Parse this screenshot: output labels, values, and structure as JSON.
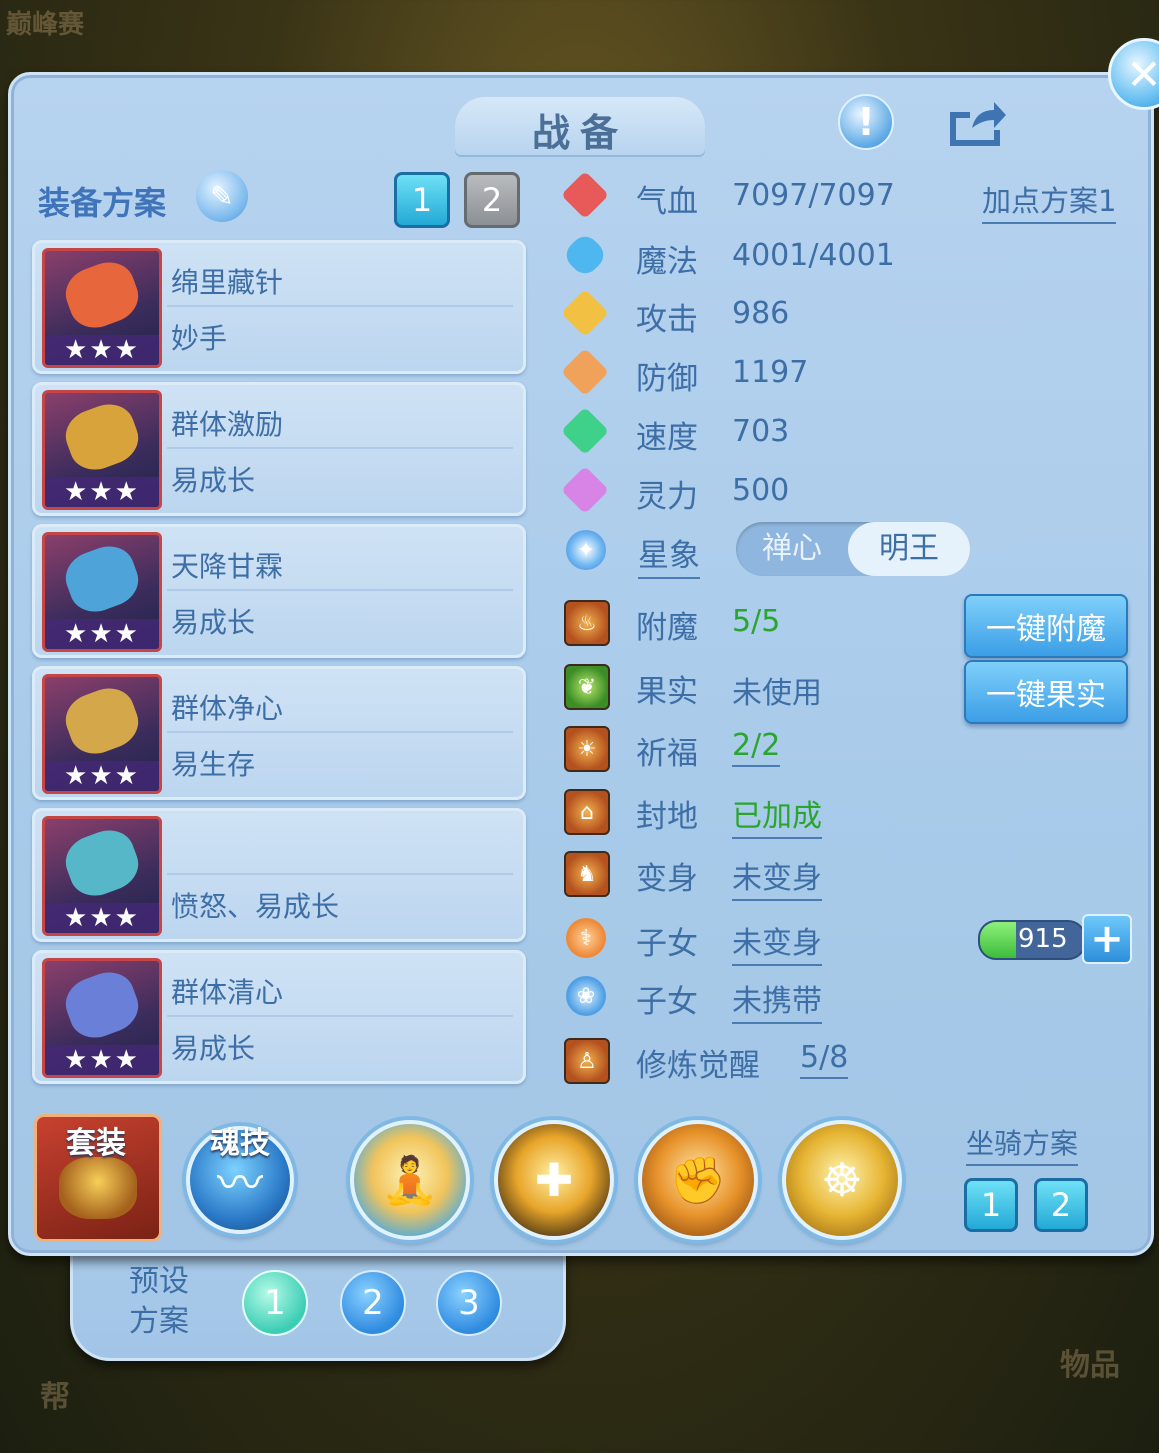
{
  "background": {
    "top_left_text": "巅峰赛",
    "bottom_right_text": "物品",
    "bottom_left_text": "帮"
  },
  "header": {
    "title": "战备",
    "help_icon": "exclamation-icon",
    "share_icon": "share-icon",
    "close_icon": "close-icon"
  },
  "equip_plan": {
    "label": "装备方案",
    "edit_icon": "pencil-icon",
    "plans": [
      "1",
      "2"
    ],
    "active_plan": "1",
    "items": [
      {
        "name": "绵里藏针",
        "sub": "妙手",
        "stars": "★★★",
        "color": "#e8663b"
      },
      {
        "name": "群体激励",
        "sub": "易成长",
        "stars": "★★★",
        "color": "#d9a33c"
      },
      {
        "name": "天降甘霖",
        "sub": "易成长",
        "stars": "★★★",
        "color": "#4ea3d8"
      },
      {
        "name": "群体净心",
        "sub": "易生存",
        "stars": "★★★",
        "color": "#d4a84a"
      },
      {
        "name": "",
        "sub": "愤怒、易成长",
        "stars": "★★★",
        "color": "#56b7c9"
      },
      {
        "name": "群体清心",
        "sub": "易成长",
        "stars": "★★★",
        "color": "#6a7fd8"
      }
    ]
  },
  "stats": {
    "point_plan": "加点方案1",
    "rows": [
      {
        "label": "气血",
        "value": "7097/7097",
        "icon": "heart-icon",
        "color": "#e85a5a"
      },
      {
        "label": "魔法",
        "value": "4001/4001",
        "icon": "mana-icon",
        "color": "#4fb7ef"
      },
      {
        "label": "攻击",
        "value": "986",
        "icon": "sword-icon",
        "color": "#f2c043"
      },
      {
        "label": "防御",
        "value": "1197",
        "icon": "shield-icon",
        "color": "#f0a15a"
      },
      {
        "label": "速度",
        "value": "703",
        "icon": "speed-icon",
        "color": "#3fd08a"
      },
      {
        "label": "灵力",
        "value": "500",
        "icon": "spirit-icon",
        "color": "#d884e6"
      }
    ],
    "constellation": {
      "label": "星象",
      "options": [
        "禅心",
        "明王"
      ],
      "selected": "明王",
      "icon": "star-compass-icon"
    }
  },
  "buffs": {
    "rows": [
      {
        "label": "附魔",
        "value": "5/5",
        "icon": "enchant-icon"
      },
      {
        "label": "果实",
        "value": "未使用",
        "icon": "fruit-icon"
      },
      {
        "label": "祈福",
        "value": "2/2",
        "icon": "blessing-icon"
      },
      {
        "label": "封地",
        "value": "已加成",
        "icon": "fief-icon"
      },
      {
        "label": "变身",
        "value": "未变身",
        "icon": "transform-icon"
      },
      {
        "label": "子女",
        "value": "未变身",
        "icon": "child-icon"
      },
      {
        "label": "子女",
        "value": "未携带",
        "icon": "paw-icon"
      },
      {
        "label": "修炼觉醒",
        "value": "5/8",
        "icon": "cultivation-icon"
      }
    ],
    "enchant_button": "一键附魔",
    "fruit_button": "一键果实",
    "energy_value": "915",
    "energy_level": 0.35,
    "plus_icon": "plus-icon"
  },
  "bottom": {
    "suit_label": "套装",
    "soul_label": "魂技",
    "mount_label": "坐骑方案",
    "mount_plans": [
      "1",
      "2"
    ],
    "preset_label": "预设方案",
    "presets": [
      "1",
      "2",
      "3"
    ],
    "skills": [
      {
        "icon": "monk-stance-icon",
        "color": "#f1c45b"
      },
      {
        "icon": "golden-shield-icon",
        "color": "#e8a52a"
      },
      {
        "icon": "monk-fist-icon",
        "color": "#e7922a"
      },
      {
        "icon": "golden-monk-icon",
        "color": "#e6b533"
      }
    ]
  }
}
